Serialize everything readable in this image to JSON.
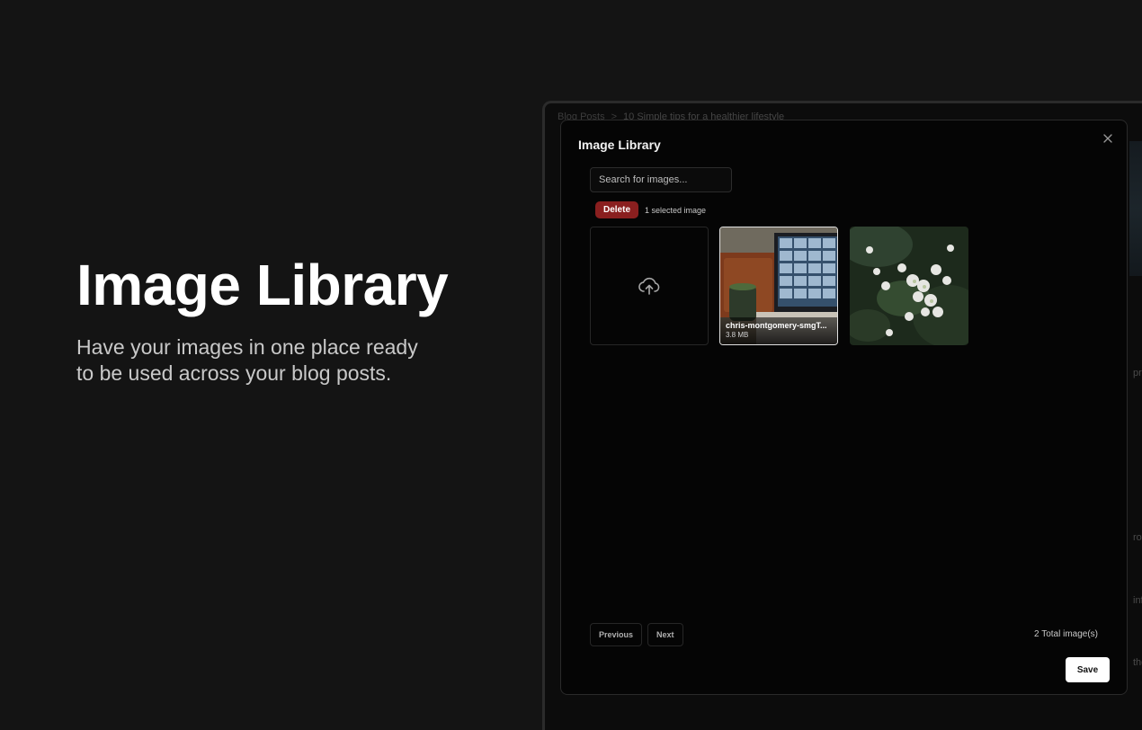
{
  "hero": {
    "title": "Image Library",
    "subtitle": "Have your images in one place ready to be used across your blog posts."
  },
  "background_app": {
    "breadcrumb": [
      "Blog Posts",
      "10 Simple tips for a healthier lifestyle"
    ],
    "side_fragments": [
      "pro",
      "rov",
      "info",
      "the"
    ]
  },
  "modal": {
    "title": "Image Library",
    "search": {
      "placeholder": "Search for images...",
      "value": ""
    },
    "delete_label": "Delete",
    "selected_text": "1 selected image",
    "images": [
      {
        "name": "chris-montgomery-smgT...",
        "size": "3.8 MB",
        "selected": true
      },
      {
        "name": "",
        "size": "",
        "selected": false
      }
    ],
    "pagination": {
      "previous_label": "Previous",
      "next_label": "Next"
    },
    "total_text": "2 Total image(s)",
    "save_label": "Save",
    "icons": {
      "close": "close-icon",
      "upload": "cloud-upload-icon"
    }
  },
  "colors": {
    "background": "#141414",
    "modal_bg": "#050505",
    "delete": "#8a1f1f",
    "save_bg": "#ffffff"
  }
}
